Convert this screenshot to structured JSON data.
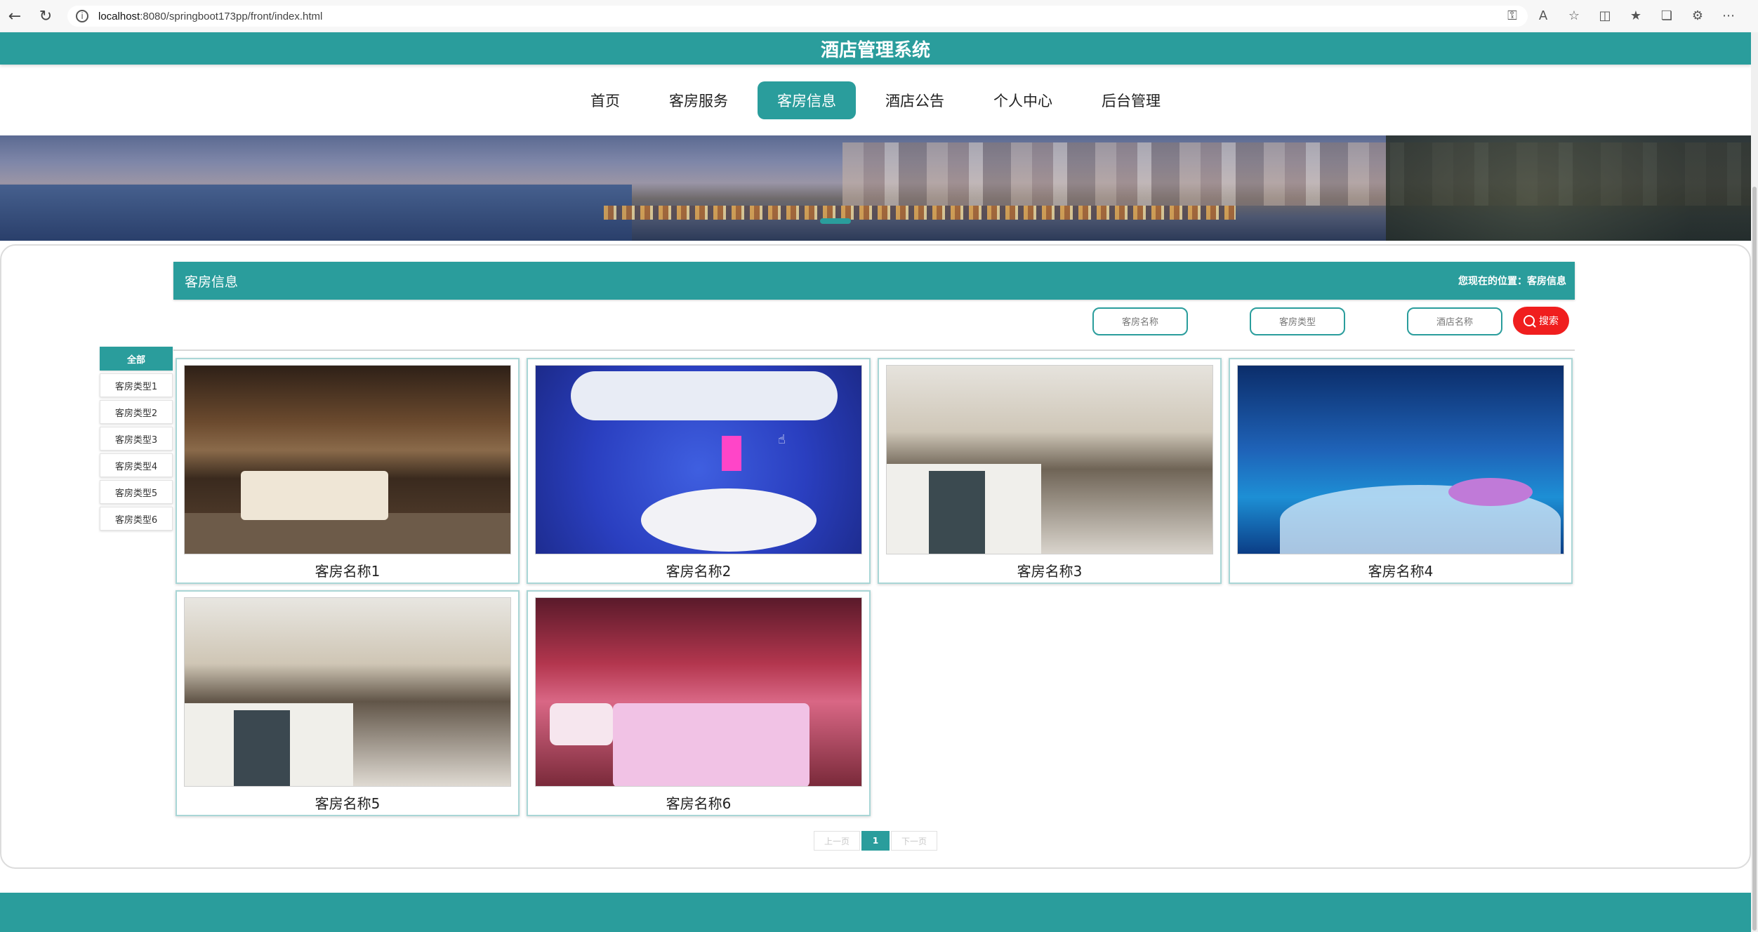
{
  "browser": {
    "url_host": "localhost",
    "url_rest": ":8080/springboot173pp/front/index.html"
  },
  "site": {
    "title": "酒店管理系统"
  },
  "nav": {
    "items": [
      "首页",
      "客房服务",
      "客房信息",
      "酒店公告",
      "个人中心",
      "后台管理"
    ],
    "active_index": 2
  },
  "section": {
    "title": "客房信息",
    "breadcrumb": "您现在的位置：客房信息"
  },
  "search": {
    "room_name_placeholder": "客房名称",
    "room_type_placeholder": "客房类型",
    "hotel_name_placeholder": "酒店名称",
    "button_label": "搜索"
  },
  "categories": [
    "全部",
    "客房类型1",
    "客房类型2",
    "客房类型3",
    "客房类型4",
    "客房类型5",
    "客房类型6"
  ],
  "rooms": [
    {
      "name": "客房名称1"
    },
    {
      "name": "客房名称2"
    },
    {
      "name": "客房名称3"
    },
    {
      "name": "客房名称4"
    },
    {
      "name": "客房名称5"
    },
    {
      "name": "客房名称6"
    }
  ],
  "pagination": {
    "prev": "上一页",
    "current": "1",
    "next": "下一页"
  },
  "colors": {
    "accent": "#2a9d9c",
    "search_button": "#f01e1e"
  }
}
